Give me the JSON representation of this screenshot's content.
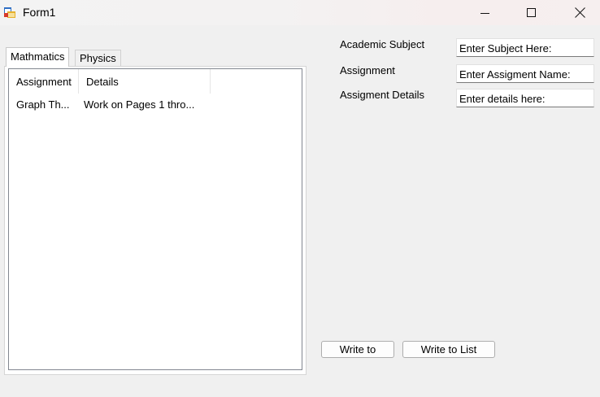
{
  "window": {
    "title": "Form1",
    "icon": "winforms-app-icon"
  },
  "tabs": [
    {
      "label": "Mathmatics",
      "active": true
    },
    {
      "label": "Physics",
      "active": false
    }
  ],
  "list": {
    "columns": [
      "Assignment",
      "Details"
    ],
    "rows": [
      [
        "Graph Th...",
        "Work on Pages 1 thro..."
      ]
    ]
  },
  "form": {
    "subject_label": "Academic Subject",
    "subject_value": "Enter Subject Here:",
    "assignment_label": "Assignment",
    "assignment_value": "Enter Assigment Name:",
    "details_label": "Assigment Details",
    "details_value": "Enter details here:"
  },
  "buttons": {
    "write_to": "Write to",
    "write_to_list": "Write to List"
  }
}
